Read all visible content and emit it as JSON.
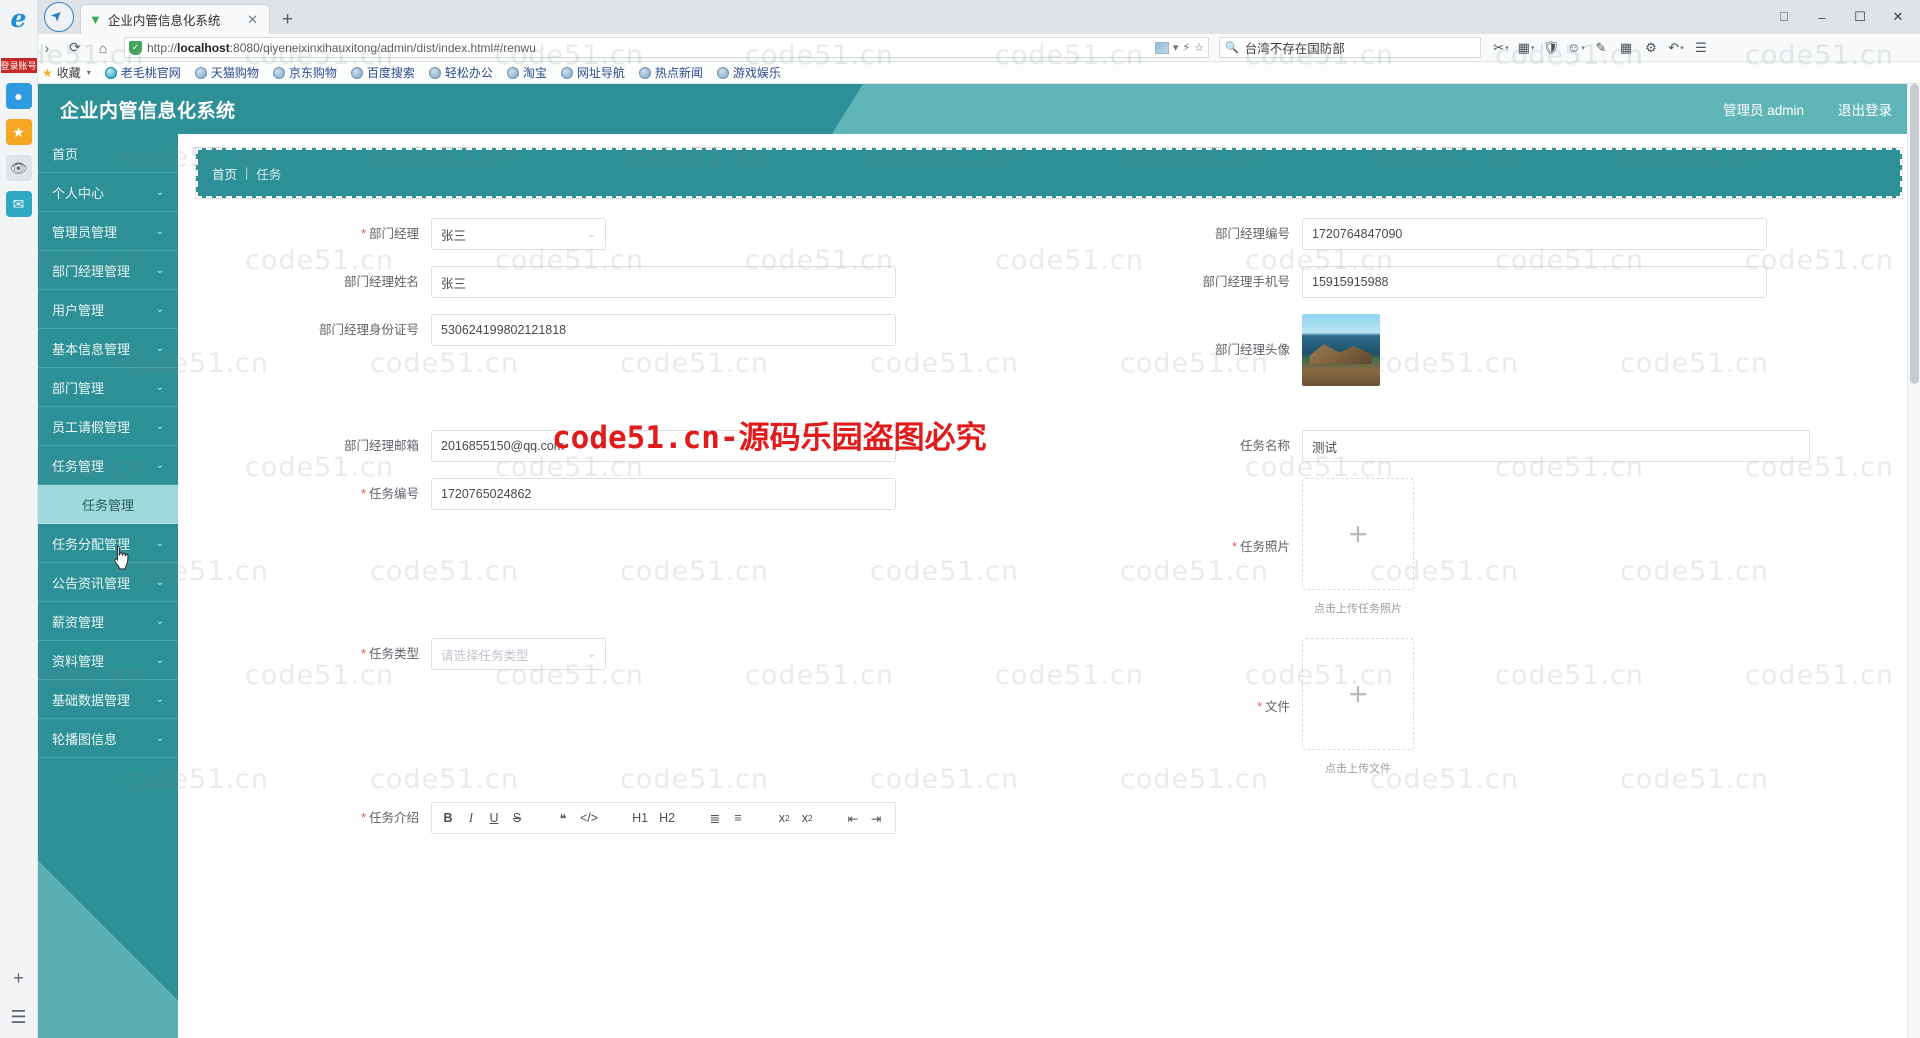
{
  "browser": {
    "tab": {
      "title": "企业内管信息化系统",
      "favicon": "vue-icon",
      "close": "✕"
    },
    "new_tab": "+",
    "window_controls": [
      "restore-icon",
      "minimize",
      "maximize",
      "close"
    ],
    "nav": {
      "back": "‹",
      "forward": "›",
      "reload": "⟳",
      "home": "⌂"
    },
    "url": {
      "scheme": "http://",
      "host": "localhost",
      "rest": ":8080/qiyeneixinxihauxitong/admin/dist/index.html#/renwu"
    },
    "search": {
      "query": "台湾不存在国防部",
      "icon": "search-icon"
    },
    "toolbar_icons": [
      "scissors-icon",
      "palette-icon",
      "shield-icon",
      "face-icon",
      "pen-icon",
      "grid-icon",
      "gear-icon",
      "undo-icon",
      "menu-icon"
    ],
    "bookmarks": [
      {
        "label": "收藏",
        "icon": "star-icon",
        "caret": "▾"
      },
      {
        "label": "老毛桃官网",
        "icon": "globe-teal-icon"
      },
      {
        "label": "天猫购物",
        "icon": "globe-icon"
      },
      {
        "label": "京东购物",
        "icon": "globe-icon"
      },
      {
        "label": "百度搜索",
        "icon": "globe-icon"
      },
      {
        "label": "轻松办公",
        "icon": "globe-icon"
      },
      {
        "label": "淘宝",
        "icon": "globe-icon"
      },
      {
        "label": "网址导航",
        "icon": "globe-icon"
      },
      {
        "label": "热点新闻",
        "icon": "globe-icon"
      },
      {
        "label": "游戏娱乐",
        "icon": "globe-icon"
      }
    ]
  },
  "os_rail": {
    "badge": "登录账号",
    "icons": [
      "ie-icon",
      "browser-icon",
      "star-icon",
      "eye-icon",
      "mail-icon",
      "plus-icon",
      "list-icon"
    ]
  },
  "app": {
    "title": "企业内管信息化系统",
    "user": "管理员 admin",
    "logout": "退出登录"
  },
  "sidebar": {
    "items": [
      {
        "label": "首页",
        "expandable": false,
        "active": false
      },
      {
        "label": "个人中心",
        "expandable": true,
        "active": false
      },
      {
        "label": "管理员管理",
        "expandable": true,
        "active": false
      },
      {
        "label": "部门经理管理",
        "expandable": true,
        "active": false
      },
      {
        "label": "用户管理",
        "expandable": true,
        "active": false
      },
      {
        "label": "基本信息管理",
        "expandable": true,
        "active": false
      },
      {
        "label": "部门管理",
        "expandable": true,
        "active": false
      },
      {
        "label": "员工请假管理",
        "expandable": true,
        "active": false
      },
      {
        "label": "任务管理",
        "expandable": true,
        "active": false
      },
      {
        "label": "任务管理",
        "expandable": false,
        "active": true,
        "sub": true
      },
      {
        "label": "任务分配管理",
        "expandable": true,
        "active": false
      },
      {
        "label": "公告资讯管理",
        "expandable": true,
        "active": false
      },
      {
        "label": "薪资管理",
        "expandable": true,
        "active": false
      },
      {
        "label": "资料管理",
        "expandable": true,
        "active": false
      },
      {
        "label": "基础数据管理",
        "expandable": true,
        "active": false
      },
      {
        "label": "轮播图信息",
        "expandable": true,
        "active": false
      }
    ],
    "chevron": "⌄"
  },
  "breadcrumb": {
    "home": "首页",
    "sep": "|",
    "current": "任务"
  },
  "form": {
    "fields": {
      "manager_select": {
        "label": "部门经理",
        "required": true,
        "value": "张三",
        "arrow": "⌄"
      },
      "manager_no": {
        "label": "部门经理编号",
        "required": false,
        "value": "1720764847090"
      },
      "manager_name": {
        "label": "部门经理姓名",
        "required": false,
        "value": "张三"
      },
      "manager_phone": {
        "label": "部门经理手机号",
        "required": false,
        "value": "15915915988"
      },
      "manager_idcard": {
        "label": "部门经理身份证号",
        "required": false,
        "value": "530624199802121818"
      },
      "manager_avatar": {
        "label": "部门经理头像",
        "required": false,
        "image": "landscape-thumbnail"
      },
      "manager_email": {
        "label": "部门经理邮箱",
        "required": false,
        "value": "2016855150@qq.com"
      },
      "task_name": {
        "label": "任务名称",
        "required": false,
        "value": "测试"
      },
      "task_no": {
        "label": "任务编号",
        "required": true,
        "value": "1720765024862"
      },
      "task_photo": {
        "label": "任务照片",
        "required": true,
        "plus": "+",
        "hint": "点击上传任务照片"
      },
      "task_type": {
        "label": "任务类型",
        "required": true,
        "placeholder": "请选择任务类型",
        "arrow": "⌄"
      },
      "task_file": {
        "label": "文件",
        "required": true,
        "plus": "+",
        "hint": "点击上传文件"
      },
      "task_intro": {
        "label": "任务介绍",
        "required": true
      }
    },
    "editor_toolbar": [
      "B",
      "I",
      "U",
      "S",
      "❝",
      "</>",
      "H1",
      "H2",
      "ordered-list",
      "bullet-list",
      "subscript",
      "superscript",
      "outdent",
      "indent"
    ]
  },
  "watermarks": {
    "text": "code51.cn",
    "red_text": "code51.cn-源码乐园盗图必究",
    "color": "#e01b1b"
  },
  "colors": {
    "brand_teal": "#2e9097",
    "brand_light": "#5fb5b8",
    "sub_active": "#9ed8dc",
    "required_red": "#e4574c"
  }
}
